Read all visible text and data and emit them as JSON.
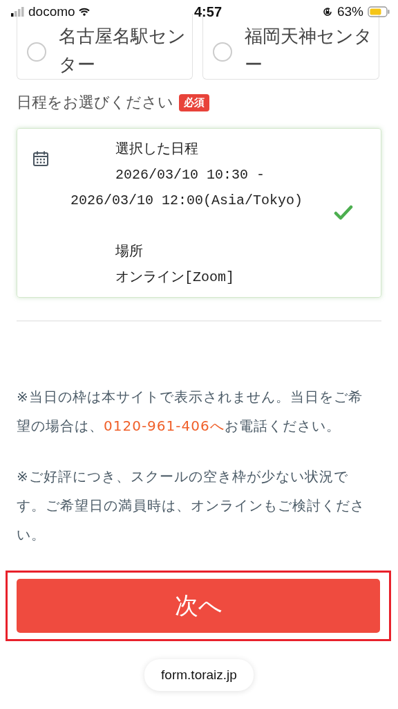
{
  "status_bar": {
    "carrier": "docomo",
    "time": "4:57",
    "battery": "63%"
  },
  "location_options": [
    {
      "label": "名古屋名駅センター",
      "selected": false
    },
    {
      "label": "福岡天神センター",
      "selected": false
    }
  ],
  "schedule": {
    "label": "日程をお選びください",
    "required_badge": "必須",
    "selected_card": {
      "schedule_heading": "選択した日程",
      "schedule_value": "2026/03/10 10:30 - 2026/03/10 12:00(Asia/Tokyo)",
      "location_heading": "場所",
      "location_value": "オンライン[Zoom]",
      "confirmed": true
    }
  },
  "notes": [
    {
      "before": "※当日の枠は本サイトで表示されません。当日をご希望の場合は、",
      "link": "0120-961-406へ",
      "after": "お電話ください。"
    },
    {
      "before": "※ご好評につき、スクールの空き枠が少ない状況です。ご希望日の満員時は、オンラインもご検討ください。"
    }
  ],
  "next_button": "次へ",
  "url_bar": "form.toraiz.jp"
}
